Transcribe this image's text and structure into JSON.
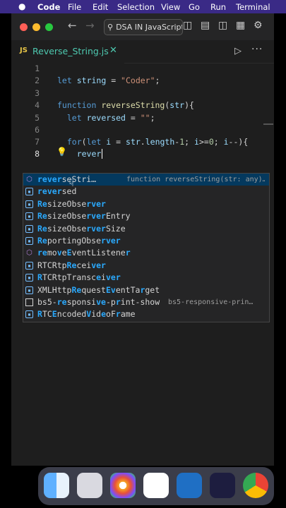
{
  "menubar": {
    "apple": "",
    "items": [
      "Code",
      "File",
      "Edit",
      "Selection",
      "View",
      "Go",
      "Run",
      "Terminal"
    ]
  },
  "titlebar": {
    "back": "←",
    "forward": "→",
    "search": "DSA IN JavaScript",
    "search_icon": "search-icon"
  },
  "tab": {
    "lang": "JS",
    "name": "Reverse_String.js",
    "close": "✕"
  },
  "actions": {
    "run": "▷",
    "more": "···"
  },
  "editor": {
    "line_numbers": [
      "1",
      "2",
      "3",
      "4",
      "5",
      "6",
      "7",
      "8"
    ],
    "active_line": "8"
  },
  "suggestions": [
    {
      "icon": "method",
      "label": "reverseString",
      "detail": "function reverseString(str: any)…",
      "selected": true
    },
    {
      "icon": "variable",
      "label": "reversed",
      "detail": ""
    },
    {
      "icon": "variable",
      "label": "ResizeObserver",
      "detail": ""
    },
    {
      "icon": "variable",
      "label": "ResizeObserverEntry",
      "detail": ""
    },
    {
      "icon": "variable",
      "label": "ResizeObserverSize",
      "detail": ""
    },
    {
      "icon": "variable",
      "label": "ReportingObserver",
      "detail": ""
    },
    {
      "icon": "method",
      "label": "removeEventListener",
      "detail": ""
    },
    {
      "icon": "variable",
      "label": "RTCRtpReceiver",
      "detail": ""
    },
    {
      "icon": "variable",
      "label": "RTCRtpTransceiver",
      "detail": ""
    },
    {
      "icon": "variable",
      "label": "XMLHttpRequestEventTarget",
      "detail": ""
    },
    {
      "icon": "snippet",
      "label": "bs5-responsive-print-show",
      "detail": "bs5-responsive-prin…"
    },
    {
      "icon": "variable",
      "label": "RTCEncodedVideoFrame",
      "detail": ""
    }
  ],
  "dock": [
    "finder-icon",
    "launchpad-icon",
    "photos-icon",
    "mongodb-icon",
    "vscode-icon",
    "media-app-icon",
    "chrome-icon"
  ],
  "colors": {
    "menubar": "#3a2a86",
    "editor_bg": "#1e1e1e",
    "match": "#2aaaff",
    "selected": "#04395e"
  }
}
